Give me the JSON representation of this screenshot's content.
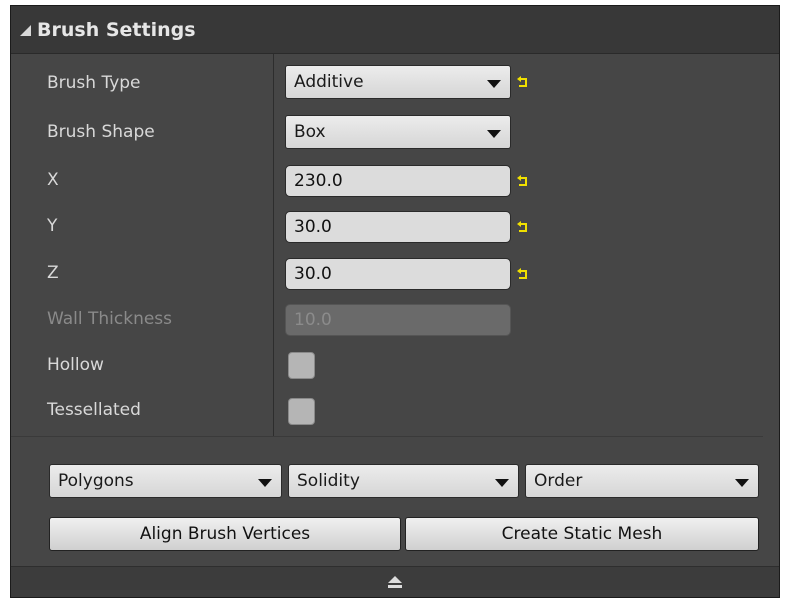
{
  "panel": {
    "title": "Brush Settings"
  },
  "properties": {
    "brush_type": {
      "label": "Brush Type",
      "value": "Additive"
    },
    "brush_shape": {
      "label": "Brush Shape",
      "value": "Box"
    },
    "x": {
      "label": "X",
      "value": "230.0"
    },
    "y": {
      "label": "Y",
      "value": "30.0"
    },
    "z": {
      "label": "Z",
      "value": "30.0"
    },
    "wall_thickness": {
      "label": "Wall Thickness",
      "value": "10.0"
    },
    "hollow": {
      "label": "Hollow"
    },
    "tessellated": {
      "label": "Tessellated"
    }
  },
  "actions": {
    "polygons": "Polygons",
    "solidity": "Solidity",
    "order": "Order",
    "align": "Align Brush Vertices",
    "create_mesh": "Create Static Mesh"
  },
  "colors": {
    "panel_bg": "#464646",
    "header_bg": "#383838",
    "reset_arrow": "#f0e000"
  },
  "icons": {
    "collapse": "collapse-triangle-icon",
    "reset": "reset-to-default-icon",
    "dropdown": "chevron-down-icon",
    "eject": "eject-icon"
  }
}
